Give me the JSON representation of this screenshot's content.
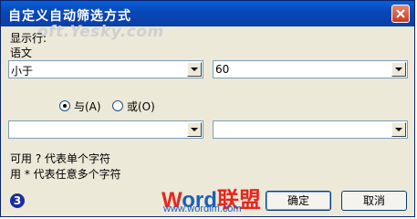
{
  "window": {
    "title": "自定义自动筛选方式"
  },
  "watermark": "oft.Yesky.com",
  "section": {
    "heading": "显示行:",
    "field_name": "语文"
  },
  "condition1": {
    "operator": "小于",
    "value": "60"
  },
  "logic": {
    "and_label": "与(A)",
    "or_label": "或(O)",
    "selected": "and"
  },
  "condition2": {
    "operator": "",
    "value": ""
  },
  "hints": {
    "line1": "可用 ? 代表单个字符",
    "line2": "用 * 代表任意多个字符"
  },
  "buttons": {
    "ok": "确定",
    "cancel": "取消"
  },
  "logo": {
    "word_w": "W",
    "word_rest": "ord",
    "word_cn": "联盟",
    "url": "www.wordlm.com"
  },
  "badge": "3",
  "colors": {
    "titlebar": "#0a5fd8",
    "dialog_bg": "#ece9d8",
    "logo_red": "#e8251d",
    "logo_blue": "#1a5ebd"
  }
}
